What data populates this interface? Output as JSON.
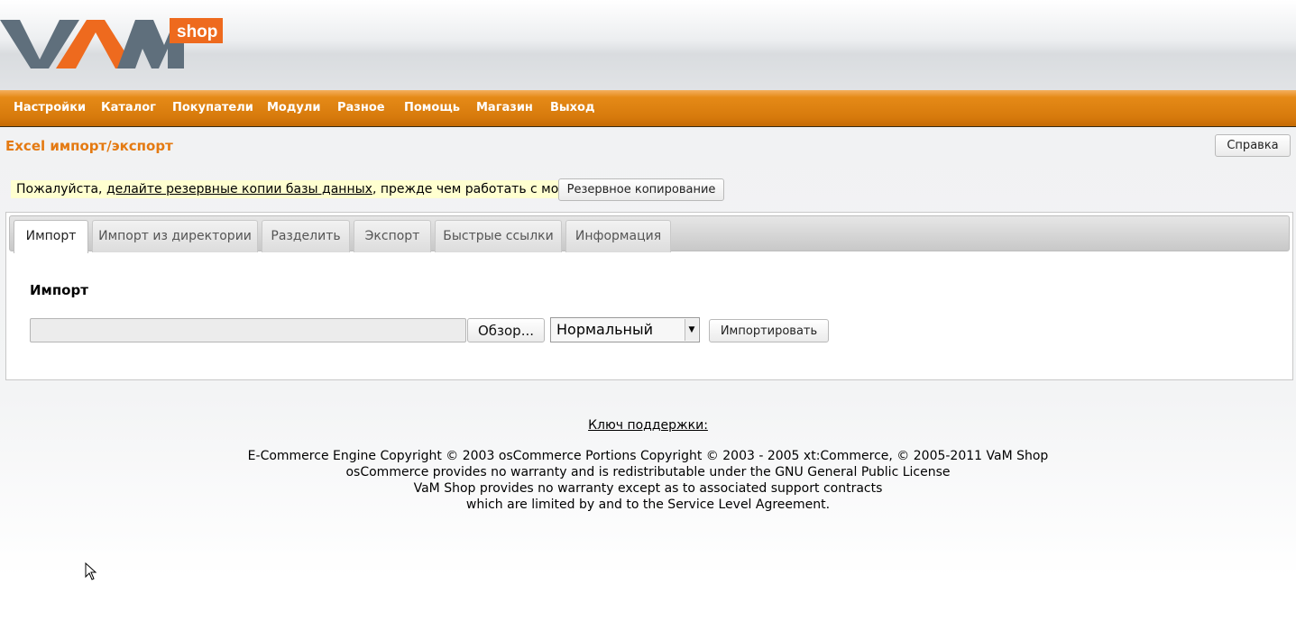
{
  "logo": {
    "main_text": "VAM",
    "badge_text": "shop"
  },
  "nav": {
    "items": [
      "Настройки",
      "Каталог",
      "Покупатели",
      "Модули",
      "Разное",
      "Помощь",
      "Магазин",
      "Выход"
    ]
  },
  "page": {
    "title": "Excel импорт/экспорт",
    "help_button": "Справка"
  },
  "notice": {
    "before": "Пожалуйста, ",
    "link": "делайте резервные копии базы данных",
    "after": ", прежде чем работать с модулем!",
    "backup_button": "Резервное копирование"
  },
  "tabs": [
    {
      "label": "Импорт",
      "active": true
    },
    {
      "label": "Импорт из директории",
      "active": false
    },
    {
      "label": "Разделить",
      "active": false
    },
    {
      "label": "Экспорт",
      "active": false
    },
    {
      "label": "Быстрые ссылки",
      "active": false
    },
    {
      "label": "Информация",
      "active": false
    }
  ],
  "import_section": {
    "title": "Импорт",
    "file_value": "",
    "browse_button": "Обзор...",
    "mode_selected": "Нормальный",
    "import_button": "Импортировать"
  },
  "footer": {
    "support_key": "Ключ поддержки:",
    "lines": [
      "E-Commerce Engine Copyright © 2003 osCommerce Portions Copyright © 2003 - 2005 xt:Commerce, © 2005-2011 VaM Shop",
      "osCommerce provides no warranty and is redistributable under the GNU General Public License",
      "VaM Shop provides no warranty except as to associated support contracts",
      "which are limited by and to the Service Level Agreement."
    ]
  },
  "colors": {
    "nav_orange": "#d77a0c",
    "title_orange": "#e47a12",
    "logo_gray": "#5f6f7c",
    "logo_orange": "#ee6a1e"
  }
}
